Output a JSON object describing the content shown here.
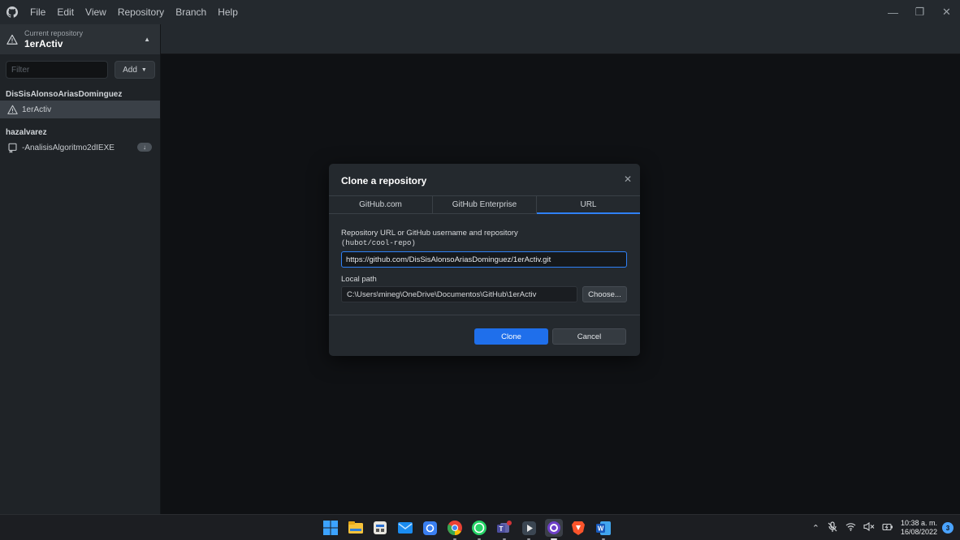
{
  "menu": {
    "items": [
      "File",
      "Edit",
      "View",
      "Repository",
      "Branch",
      "Help"
    ]
  },
  "toolbar": {
    "repo_caption": "Current repository",
    "repo_name": "1erActiv"
  },
  "sidebar": {
    "filter_placeholder": "Filter",
    "add_label": "Add",
    "groups": [
      {
        "owner": "DisSisAlonsoAriasDominguez",
        "repos": [
          {
            "name": "1erActiv",
            "icon": "warning-icon"
          }
        ]
      },
      {
        "owner": "hazalvarez",
        "repos": [
          {
            "name": "-AnalisisAlgoritmo2dIEXE",
            "icon": "repo-icon",
            "badge": "↓"
          }
        ]
      }
    ]
  },
  "dialog": {
    "title": "Clone a repository",
    "tabs": [
      "GitHub.com",
      "GitHub Enterprise",
      "URL"
    ],
    "active_tab": "URL",
    "url_label": "Repository URL or GitHub username and repository",
    "url_hint": "(hubot/cool-repo)",
    "url_value": "https://github.com/DisSisAlonsoAriasDominguez/1erActiv.git",
    "path_label": "Local path",
    "path_value": "C:\\Users\\mineg\\OneDrive\\Documentos\\GitHub\\1erActiv",
    "choose_label": "Choose...",
    "clone_label": "Clone",
    "cancel_label": "Cancel"
  },
  "taskbar": {
    "apps": [
      "windows-start-icon",
      "file-explorer-icon",
      "calendar-app-icon",
      "mail-icon",
      "chat-icon",
      "chrome-icon",
      "whatsapp-icon",
      "teams-icon",
      "media-player-icon",
      "github-desktop-icon",
      "brave-icon",
      "word-icon"
    ],
    "time": "10:38 a. m.",
    "date": "16/08/2022",
    "notifications": "3"
  },
  "colors": {
    "accent": "#2f81f7",
    "primary_button": "#1f6feb",
    "bg": "#0f1114",
    "chrome": "#24292e"
  }
}
